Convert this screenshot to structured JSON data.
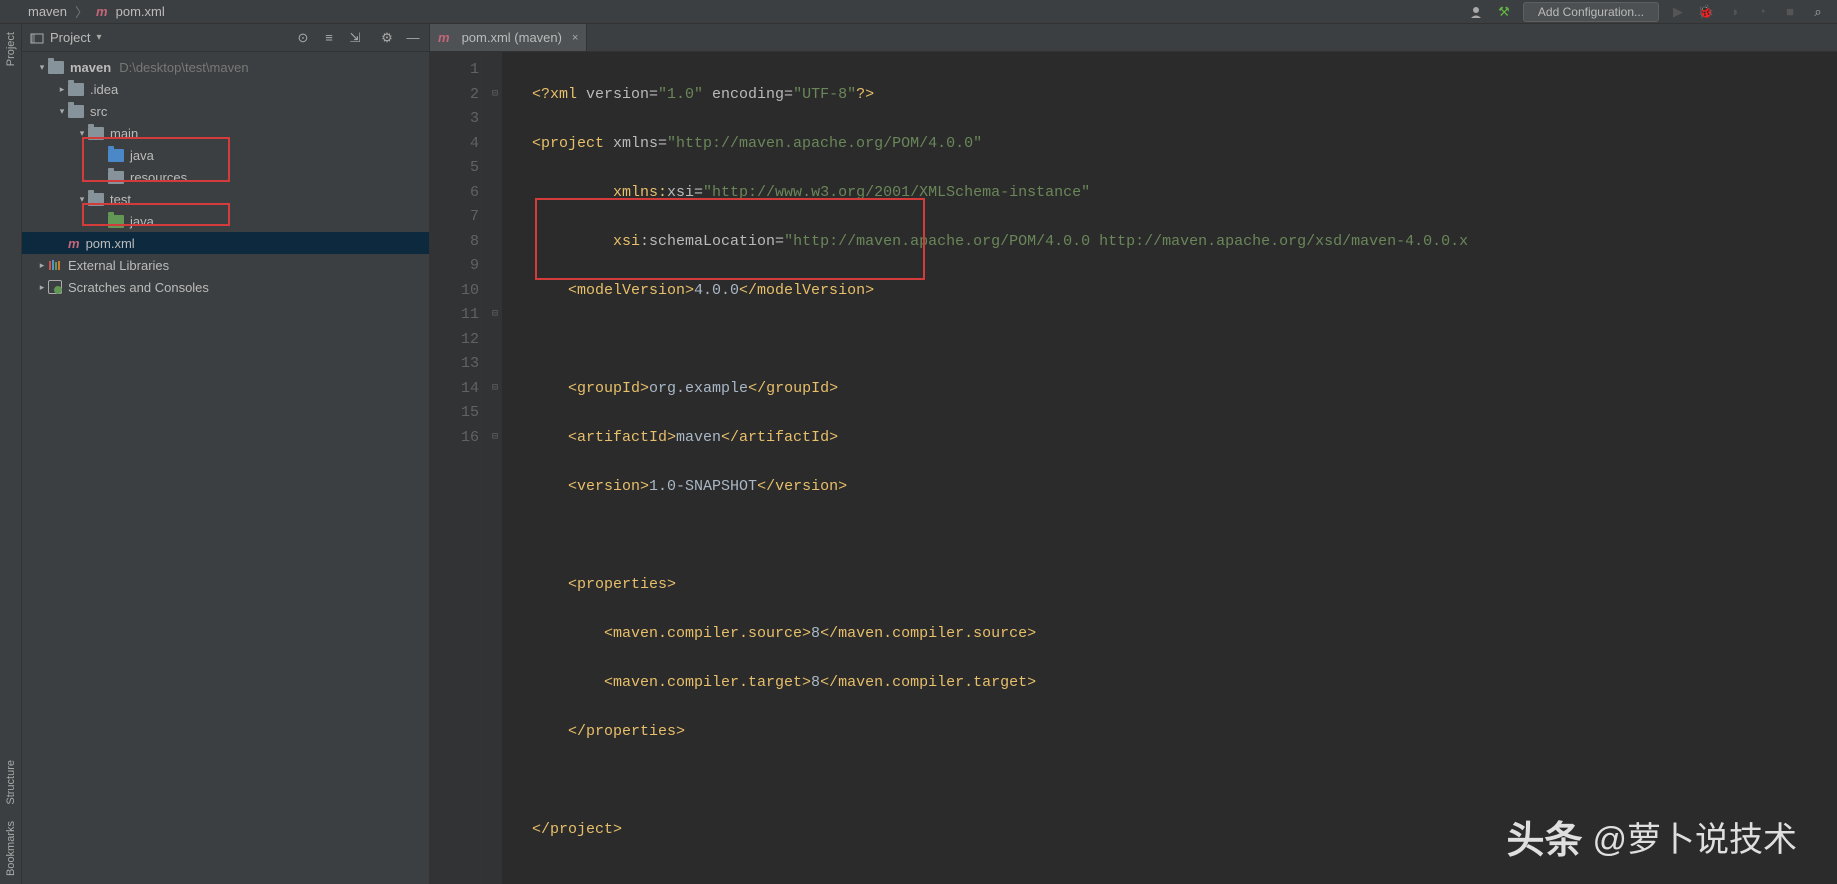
{
  "breadcrumb": {
    "project": "maven",
    "file_icon": "m",
    "file": "pom.xml"
  },
  "toolbar": {
    "add_config": "Add Configuration..."
  },
  "panel": {
    "title": "Project",
    "tree": {
      "root": {
        "name": "maven",
        "path": "D:\\desktop\\test\\maven"
      },
      "idea": ".idea",
      "src": "src",
      "main": "main",
      "java1": "java",
      "resources": "resources",
      "test": "test",
      "java2": "java",
      "pom": "pom.xml",
      "libs": "External Libraries",
      "scratches": "Scratches and Consoles"
    }
  },
  "editor": {
    "tab_icon": "m",
    "tab_label": "pom.xml (maven)",
    "lines": [
      1,
      2,
      3,
      4,
      5,
      6,
      7,
      8,
      9,
      10,
      11,
      12,
      13,
      14,
      15,
      16
    ]
  },
  "code": {
    "l1_a": "<?xml ",
    "l1_b": "version=",
    "l1_c": "\"1.0\"",
    "l1_d": " encoding=",
    "l1_e": "\"UTF-8\"",
    "l1_f": "?>",
    "l2_a": "<project ",
    "l2_b": "xmlns=",
    "l2_c": "\"http://maven.apache.org/POM/4.0.0\"",
    "l3_a": "         xmlns:",
    "l3_b": "xsi=",
    "l3_c": "\"http://www.w3.org/2001/XMLSchema-instance\"",
    "l4_a": "         xsi",
    "l4_b": ":schemaLocation=",
    "l4_c": "\"http://maven.apache.org/POM/4.0.0 http://maven.apache.org/xsd/maven-4.0.0.x",
    "l5_a": "    <modelVersion>",
    "l5_b": "4.0.0",
    "l5_c": "</modelVersion>",
    "l7_a": "    <groupId>",
    "l7_b": "org.example",
    "l7_c": "</groupId>",
    "l8_a": "    <artifactId>",
    "l8_b": "maven",
    "l8_c": "</artifactId>",
    "l9_a": "    <version>",
    "l9_b": "1.0-SNAPSHOT",
    "l9_c": "</version>",
    "l11_a": "    <properties>",
    "l12_a": "        <maven.compiler.source>",
    "l12_b": "8",
    "l12_c": "</maven.compiler.source>",
    "l13_a": "        <maven.compiler.target>",
    "l13_b": "8",
    "l13_c": "</maven.compiler.target>",
    "l14_a": "    </properties>",
    "l16_a": "</project>"
  },
  "rails": {
    "project": "Project",
    "bookmarks": "Bookmarks",
    "structure": "Structure"
  },
  "watermark": {
    "logo": "头条",
    "text": "@萝卜说技术"
  }
}
